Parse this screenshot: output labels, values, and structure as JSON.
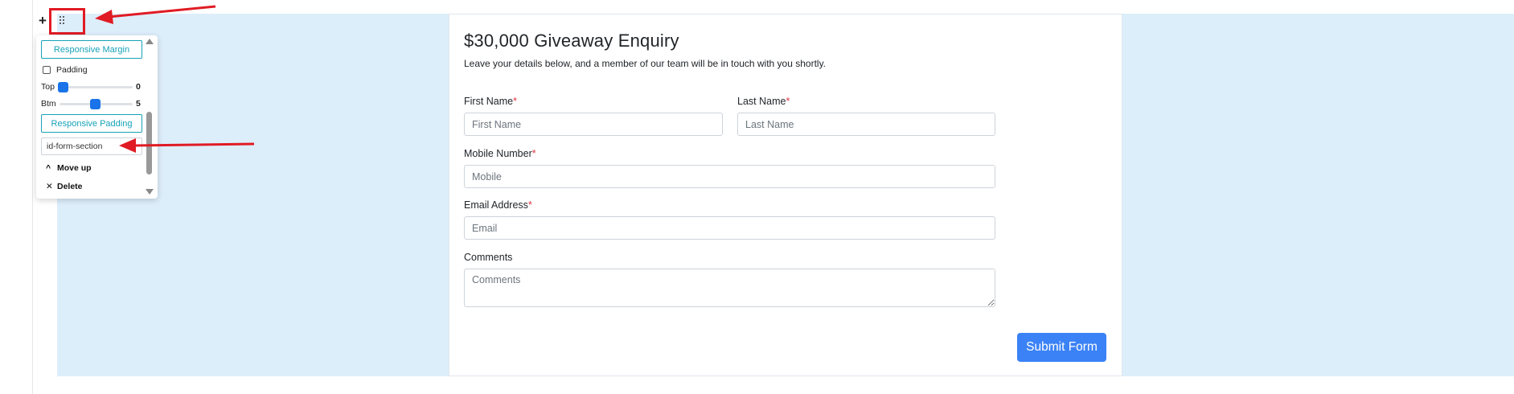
{
  "form": {
    "title": "$30,000 Giveaway Enquiry",
    "subtitle": "Leave your details below, and a member of our team will be in touch with you shortly.",
    "first_name": {
      "label": "First Name",
      "required_mark": "*",
      "placeholder": "First Name"
    },
    "last_name": {
      "label": "Last Name",
      "required_mark": "*",
      "placeholder": "Last Name"
    },
    "mobile": {
      "label": "Mobile Number",
      "required_mark": "*",
      "placeholder": "Mobile"
    },
    "email": {
      "label": "Email Address",
      "required_mark": "*",
      "placeholder": "Email"
    },
    "comments": {
      "label": "Comments",
      "placeholder": "Comments"
    },
    "submit_label": "Submit Form"
  },
  "editor": {
    "add_icon": "plus-icon",
    "drag_icon": "drag-handle-icon",
    "panel": {
      "responsive_margin_label": "Responsive Margin",
      "padding_label": "Padding",
      "padding_checked": false,
      "top_label": "Top",
      "top_value": "0",
      "bottom_label": "Btm",
      "bottom_value": "5",
      "responsive_padding_label": "Responsive Padding",
      "id_value": "id-form-section",
      "move_up_label": "Move up",
      "move_up_icon": "chevron-up-icon",
      "delete_label": "Delete",
      "delete_icon": "close-icon"
    }
  },
  "colors": {
    "section_background": "#ddeefb",
    "accent": "#3b82f6",
    "teal_outline": "#17a2b8",
    "required": "#dc3545",
    "annotation": "#e01b24"
  }
}
